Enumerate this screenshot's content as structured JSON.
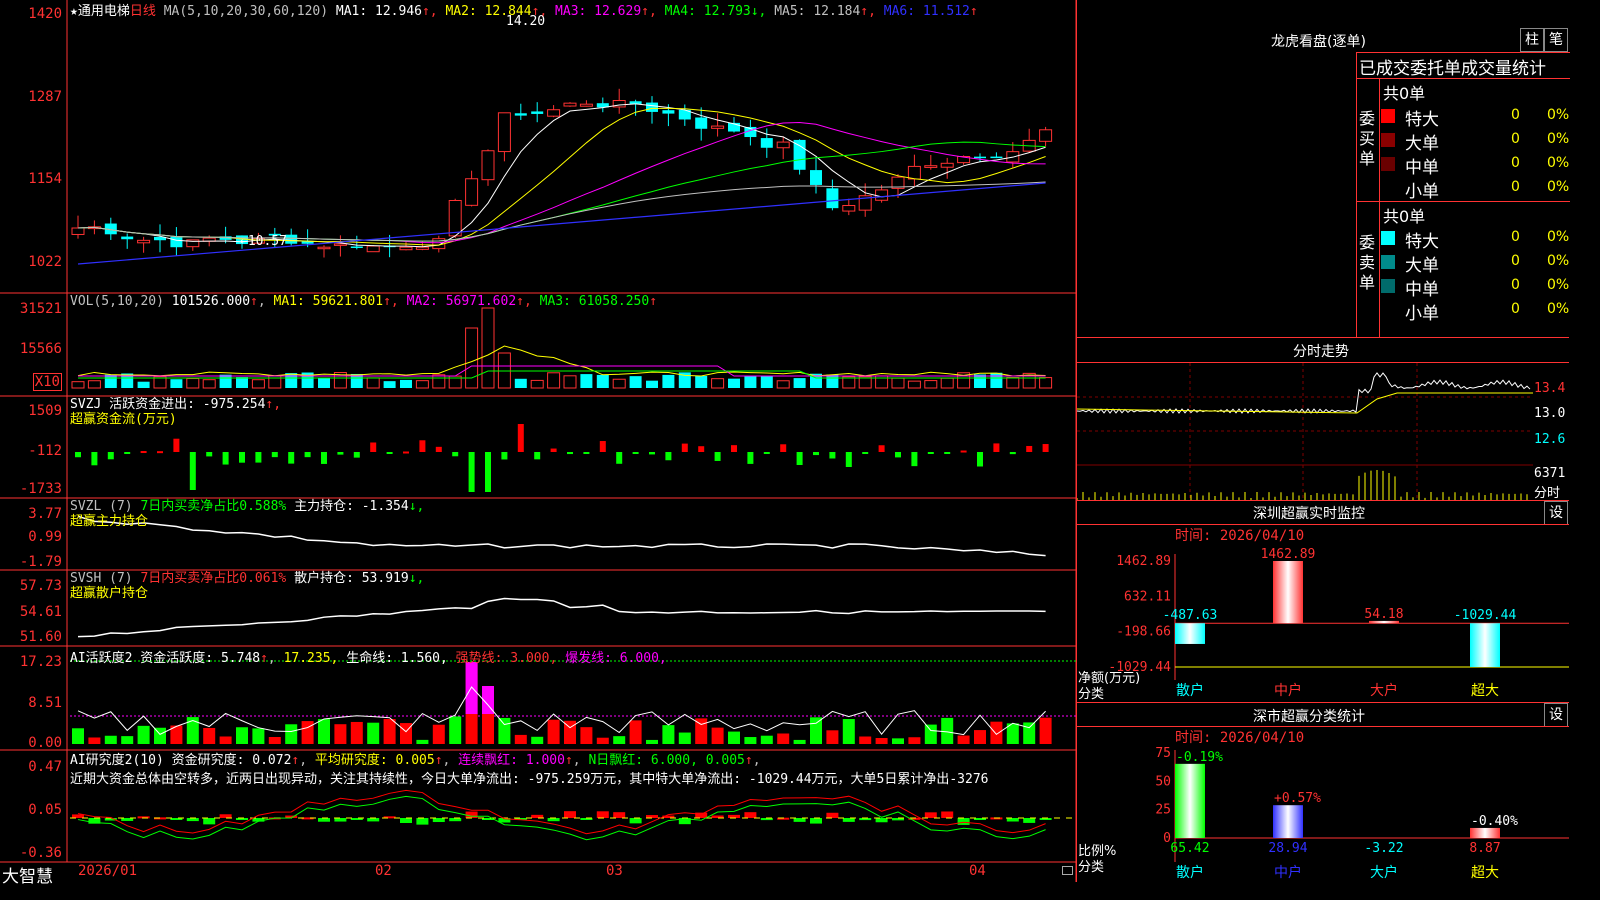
{
  "main": {
    "stock_name": "通用电梯",
    "period": "日线",
    "ma_params": "MA(5,10,20,30,60,120)",
    "ma_values": [
      {
        "label": "MA1:",
        "value": "12.946",
        "arrow": "↑",
        "color": "#ffffff"
      },
      {
        "label": "MA2:",
        "value": "12.844",
        "arrow": "↑",
        "color": "#ffff00"
      },
      {
        "label": "MA3:",
        "value": "12.629",
        "arrow": "↑",
        "color": "#ff00ff"
      },
      {
        "label": "MA4:",
        "value": "12.793",
        "arrow": "↓",
        "color": "#00ff00"
      },
      {
        "label": "MA5:",
        "value": "12.184",
        "arrow": "↑",
        "color": "#c0c0c0"
      },
      {
        "label": "MA6:",
        "value": "11.512",
        "arrow": "↑",
        "color": "#3030ff"
      }
    ],
    "high_marker": "14.20",
    "low_marker": "←10.57",
    "y_ticks": [
      "1420",
      "1287",
      "1154",
      "1022"
    ]
  },
  "vol": {
    "title": "VOL(5,10,20)",
    "value": "101526.000",
    "ma": [
      {
        "label": "MA1:",
        "value": "59621.801",
        "arrow": "↑",
        "color": "#ffff00"
      },
      {
        "label": "MA2:",
        "value": "56971.602",
        "arrow": "↑",
        "color": "#ff00ff"
      },
      {
        "label": "MA3:",
        "value": "61058.250",
        "arrow": "↑",
        "color": "#00ff00"
      }
    ],
    "y_ticks": [
      "31521",
      "15566"
    ],
    "unit": "X10"
  },
  "svzj": {
    "line1": "SVZJ  活跃资金进出: -975.254",
    "arrow": "↑,",
    "line2": "超赢资金流(万元)",
    "y_ticks": [
      "1509",
      "-112",
      "-1733"
    ]
  },
  "svzl": {
    "title": "SVZL (7)",
    "ratio": "7日内买卖净占比0.588%",
    "holding": "主力持仓: -1.354",
    "arrow": "↓,",
    "line2": "超赢主力持仓",
    "y_ticks": [
      "3.77",
      "0.99",
      "-1.79"
    ]
  },
  "svsh": {
    "title": "SVSH (7)",
    "ratio": "7日内买卖净占比0.061%",
    "holding": "散户持仓: 53.919",
    "arrow": "↓,",
    "line2": "超赢散户持仓",
    "y_ticks": [
      "57.73",
      "54.61",
      "51.60"
    ]
  },
  "ai_active": {
    "title": "AI活跃度2 资金活跃度: 5.748",
    "v2": "17.235,",
    "life": "生命线: 1.560,",
    "strong": "强势线: 3.000,",
    "burst": "爆发线: 6.000,",
    "y_ticks": [
      "17.23",
      "8.51",
      "0.00"
    ]
  },
  "ai_research": {
    "title": "AI研究度2(10) 资金研究度: 0.072",
    "avg": "平均研究度: 0.005",
    "cont": "连续飘红: 1.000",
    "n": "N日飘红: 6.000, 0.005",
    "comment": "近期大资金总体由空转多，近两日出现异动，关注其持续性，今日大单净流出: -975.259万元，其中特大单净流出: -1029.44万元，大单5日累计净出-3276",
    "y_ticks": [
      "0.47",
      "0.05",
      "-0.36"
    ]
  },
  "xaxis": [
    "2026/01",
    "02",
    "03",
    "04"
  ],
  "logo": "大智慧",
  "right": {
    "dragon_title": "龙虎看盘(逐单)",
    "btn_zhu": "柱",
    "btn_bi": "笔",
    "stats_header": "已成交委托单成交量统计",
    "buy_label": "委买单",
    "sell_label": "委卖单",
    "buy_total": "共0单",
    "sell_total": "共0单",
    "buy_rows": [
      {
        "name": "特大",
        "n": "0",
        "pct": "0%",
        "color": "#ff0000"
      },
      {
        "name": "大单",
        "n": "0",
        "pct": "0%",
        "color": "#8b0000"
      },
      {
        "name": "中单",
        "n": "0",
        "pct": "0%",
        "color": "#6a0000"
      },
      {
        "name": "小单",
        "n": "0",
        "pct": "0%",
        "color": "#000000"
      }
    ],
    "sell_rows": [
      {
        "name": "特大",
        "n": "0",
        "pct": "0%",
        "color": "#00ffff"
      },
      {
        "name": "大单",
        "n": "0",
        "pct": "0%",
        "color": "#008b8b"
      },
      {
        "name": "中单",
        "n": "0",
        "pct": "0%",
        "color": "#006b6b"
      },
      {
        "name": "小单",
        "n": "0",
        "pct": "0%",
        "color": "#000000"
      }
    ],
    "intraday_title": "分时走势",
    "intraday_ticks": [
      "13.4",
      "13.0",
      "12.6"
    ],
    "intraday_vol": "6371",
    "intraday_unit": "分时",
    "monitor_title": "深圳超赢实时监控",
    "monitor_btn": "设",
    "monitor_time": "时间: 2026/04/10",
    "monitor_y": [
      "1462.89",
      "632.11",
      "-198.66",
      "-1029.44"
    ],
    "monitor_axis_label1": "净额(万元)",
    "monitor_axis_label2": "分类",
    "monitor_bars": [
      {
        "cat": "散户",
        "value": "-487.63",
        "color": "#00ffff",
        "num": -487.63
      },
      {
        "cat": "中户",
        "value": "1462.89",
        "color": "#ff3232",
        "num": 1462.89
      },
      {
        "cat": "大户",
        "value": "54.18",
        "color": "#ff3232",
        "num": 54.18
      },
      {
        "cat": "超大",
        "value": "-1029.44",
        "color": "#00ffff",
        "num": -1029.44
      }
    ],
    "class_title": "深市超赢分类统计",
    "class_btn": "设",
    "class_time": "时间: 2026/04/10",
    "class_y": [
      "75",
      "50",
      "25",
      "0"
    ],
    "class_axis_label1": "比例%",
    "class_axis_label2": "分类",
    "class_bars": [
      {
        "cat": "散户",
        "top": "-0.19%",
        "bottom": "65.42",
        "color": "#00ff00",
        "num": 65.42
      },
      {
        "cat": "中户",
        "top": "+0.57%",
        "bottom": "28.94",
        "color": "#3030ff",
        "num": 28.94
      },
      {
        "cat": "大户",
        "top": "",
        "bottom": "-3.22",
        "color": "#00ffff",
        "num": 0
      },
      {
        "cat": "超大",
        "top": "-0.40%",
        "bottom": "8.87",
        "color": "#ff3232",
        "num": 8.87
      }
    ]
  }
}
